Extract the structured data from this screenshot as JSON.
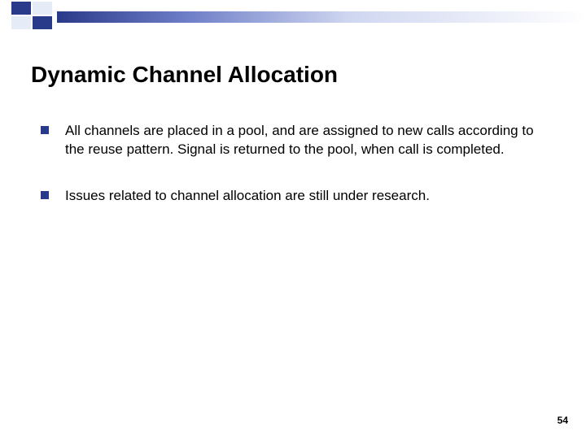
{
  "title": "Dynamic Channel Allocation",
  "bullets": [
    "All channels are placed in a pool, and are assigned to new calls according to the reuse pattern. Signal is returned to the pool, when call is completed.",
    "Issues related to channel allocation are still under research."
  ],
  "page_number": "54",
  "colors": {
    "accent": "#2a3a8a"
  }
}
